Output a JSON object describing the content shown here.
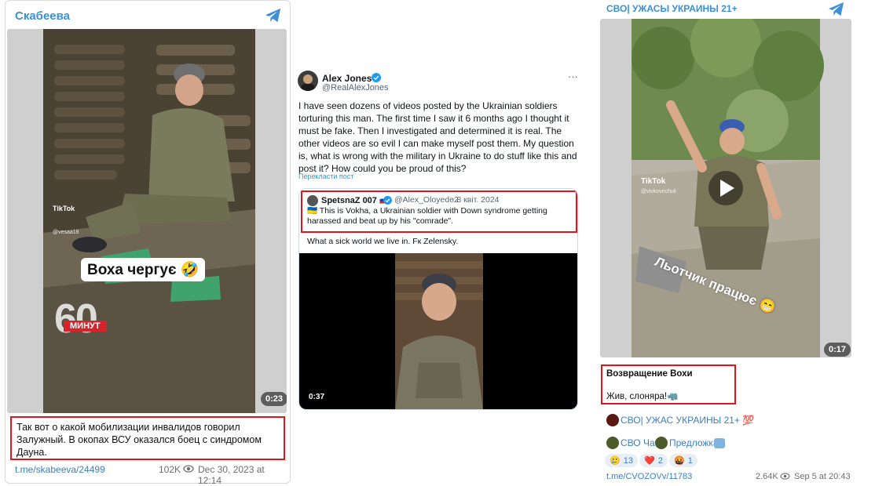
{
  "left_post": {
    "channel": "Скабеева",
    "tiktok_label": "TikTok",
    "tiktok_user": "@vesaa18",
    "caption_overlay": "Воха чергує 🤣",
    "badge_number": "60",
    "badge_word": "МИНУТ",
    "duration": "0:23",
    "body_text": "Так вот о какой мобилизации инвалидов говорил Залужный. В окопах ВСУ оказался боец с синдромом Дауна.",
    "link": "t.me/skabeeva/24499",
    "views": "102K",
    "date": "Dec 30, 2023 at 12:14"
  },
  "tweet": {
    "author_name": "Alex Jones",
    "author_handle": "@RealAlexJones",
    "more": "···",
    "text": "I have seen dozens of videos posted by the Ukrainian soldiers torturing this man. The first time I saw it 6 months ago I thought it must be fake. Then I investigated and determined it is real. The other videos are so evil I can make myself post them. My question is, what is wrong with the military in Ukraine to do stuff like this and post it? How could you be proud of this?",
    "translate": "Перекласти пост",
    "quote": {
      "name": "SpetsnaZ 007 🇷🇺",
      "handle": "@Alex_Oloyede2",
      "date": "· 8 квіт. 2024",
      "text": "🇺🇦 This is Vokha, a Ukrainian soldier with Down syndrome getting harassed and beat up by his \"comrade\".",
      "reply_text": "What a sick world we live in. Fк Zelensky.",
      "duration": "0:37"
    }
  },
  "right_post": {
    "channel": "СВО| УЖАСЫ УКРАИНЫ 21+",
    "tiktok_label": "TikTok",
    "tiktok_user": "@vivkovechuk",
    "overlay_text": "Льотчик працює 😁",
    "duration": "0:17",
    "body_line1": "Возвращение Вохи",
    "body_line2": "Жив, слоняра!🦏",
    "channel_link": "СВО| УЖАС УКРАИНЫ 21+ 💯",
    "chat_link": "СВО Чат",
    "suggest_link": "Предложка",
    "reactions": [
      {
        "emoji": "🥲",
        "count": "13"
      },
      {
        "emoji": "❤️",
        "count": "2"
      },
      {
        "emoji": "🤬",
        "count": "1"
      }
    ],
    "link": "t.me/CVOZOVv/11783",
    "views": "2.64K",
    "date": "Sep 5 at 20:43"
  },
  "colors": {
    "telegram_blue": "#3d8fd6",
    "highlight_red": "#e0141c",
    "verified_blue": "#1d9bf0"
  }
}
